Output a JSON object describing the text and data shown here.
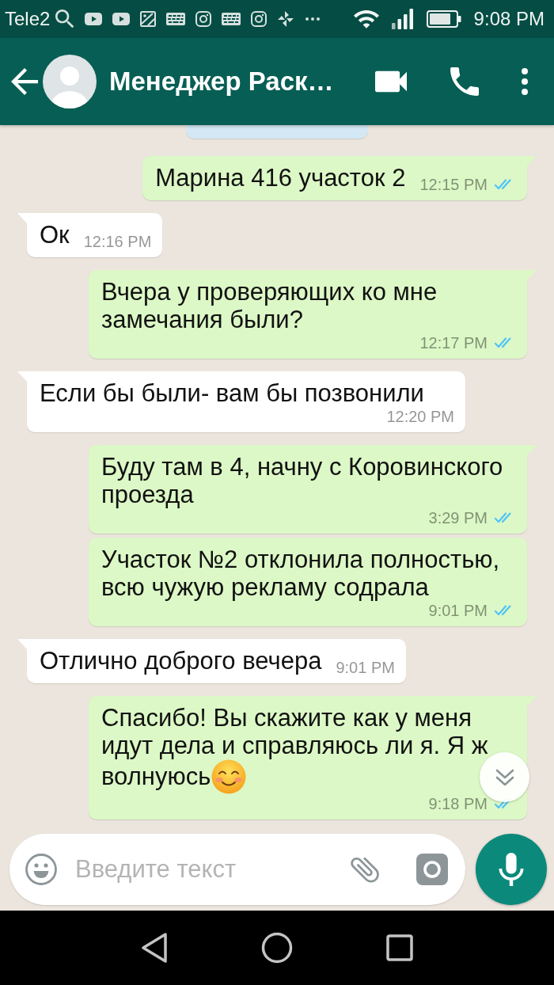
{
  "status_bar": {
    "carrier": "Tele2",
    "time": "9:08 PM"
  },
  "header": {
    "title": "Менеджер Раск…"
  },
  "messages": [
    {
      "kind": "outgoing",
      "text": "Марина 416 участок 2",
      "time": "12:15 PM",
      "read": true
    },
    {
      "kind": "incoming",
      "text": "Ок",
      "time": "12:16 PM"
    },
    {
      "kind": "outgoing",
      "text": "Вчера у проверяющих ко мне замечания были?",
      "time": "12:17 PM",
      "read": true
    },
    {
      "kind": "incoming",
      "text": "Если бы были- вам бы позвонили",
      "time": "12:20 PM"
    },
    {
      "kind": "outgoing",
      "text": "Буду там в 4, начну с Коровинского проезда",
      "time": "3:29 PM",
      "read": true
    },
    {
      "kind": "outgoing",
      "text": "Участок №2 отклонила полностью, всю чужую рекламу содрала",
      "time": "9:01 PM",
      "read": true
    },
    {
      "kind": "incoming",
      "text": "Отлично доброго вечера",
      "time": "9:01 PM"
    },
    {
      "kind": "outgoing",
      "text": "Спасибо! Вы скажите как у меня идут дела и справляюсь ли я. Я ж волнуюсь",
      "emoji": true,
      "time": "9:18 PM",
      "read": true
    }
  ],
  "composer": {
    "placeholder": "Введите текст"
  }
}
